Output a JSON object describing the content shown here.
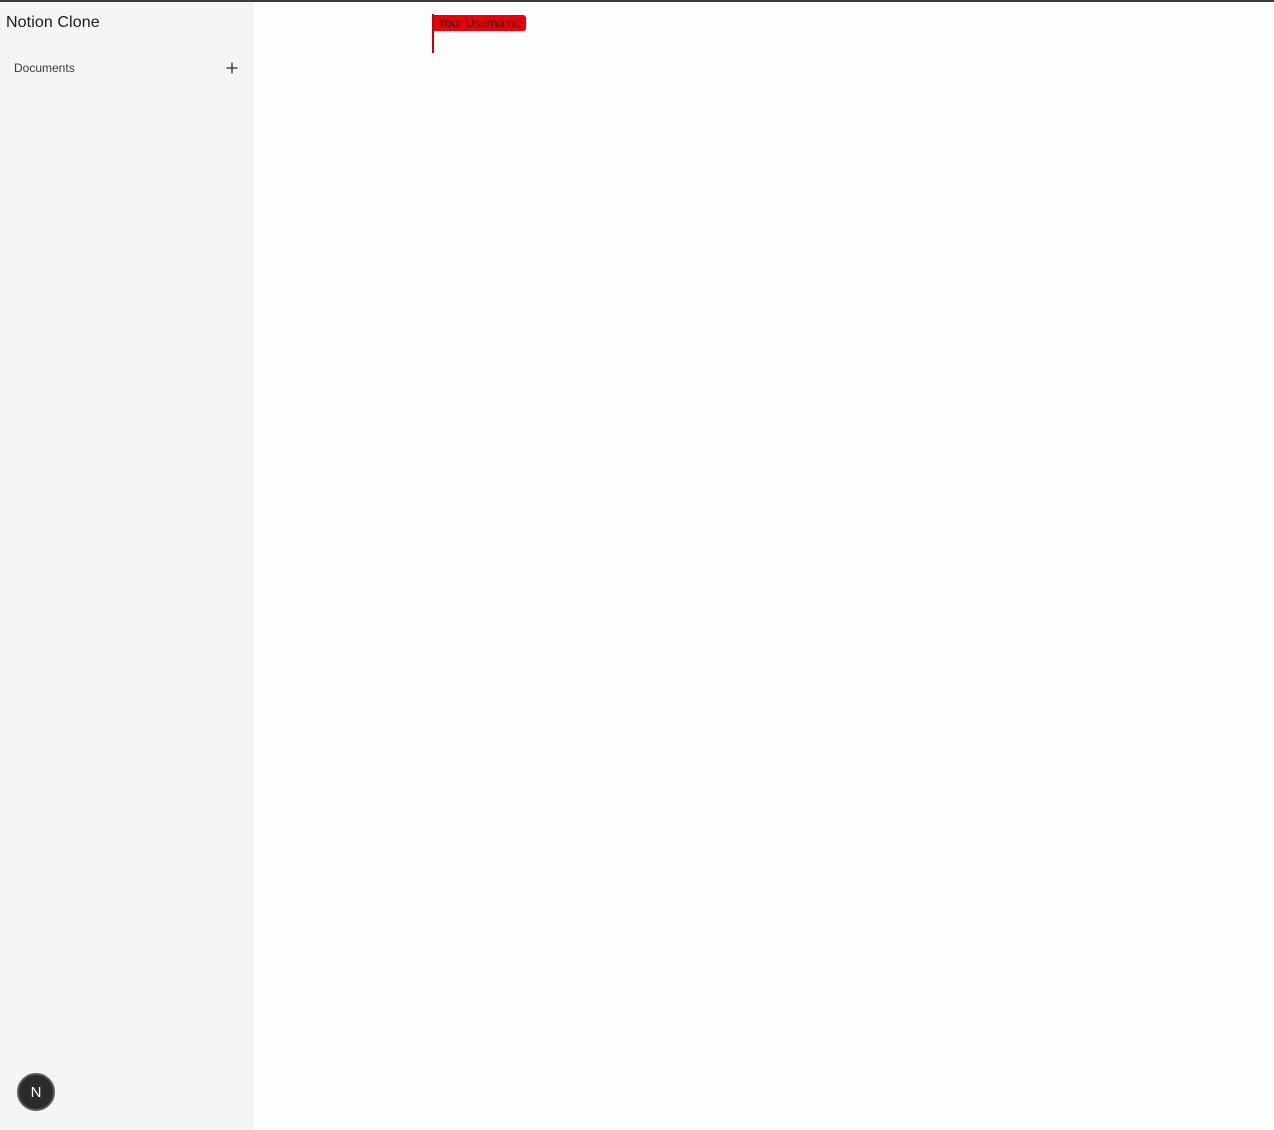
{
  "sidebar": {
    "app_title": "Notion Clone",
    "section": {
      "label": "Documents",
      "add_icon": "plus-icon"
    },
    "avatar": {
      "initial": "N"
    }
  },
  "editor": {
    "collaborator_cursor": {
      "label": "Your Username",
      "color": "#e8000b"
    }
  },
  "colors": {
    "sidebar_bg": "#f8f8f8",
    "main_bg": "#fdfdfd",
    "avatar_bg": "#2b2b2b"
  }
}
